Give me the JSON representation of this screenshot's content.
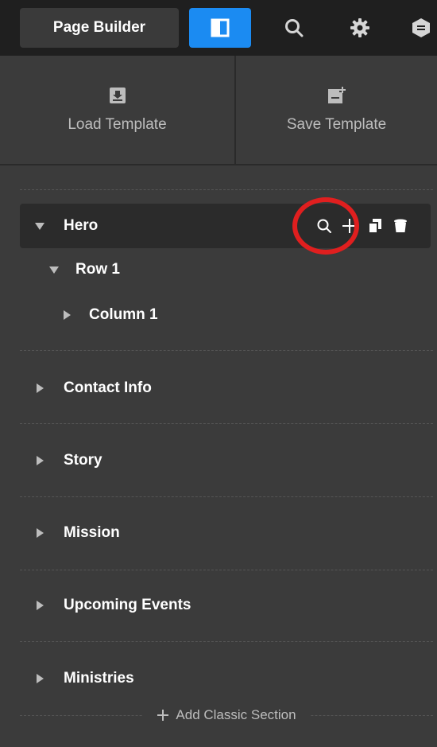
{
  "header": {
    "app_button_label": "Page Builder",
    "icons": [
      "layout-panel-icon",
      "search-icon",
      "gear-icon",
      "more-icon"
    ]
  },
  "templates": {
    "load_label": "Load Template",
    "save_label": "Save Template"
  },
  "tree": {
    "hero": {
      "label": "Hero",
      "expanded": true,
      "actions": [
        "search-icon",
        "plus-icon",
        "duplicate-icon",
        "delete-icon"
      ],
      "row": {
        "label": "Row 1",
        "expanded": true,
        "column": {
          "label": "Column 1",
          "expanded": false
        }
      }
    },
    "sections": [
      {
        "label": "Contact Info"
      },
      {
        "label": "Story"
      },
      {
        "label": "Mission"
      },
      {
        "label": "Upcoming Events"
      },
      {
        "label": "Ministries"
      }
    ]
  },
  "footer": {
    "add_section_label": "Add Classic Section"
  },
  "colors": {
    "accent": "#1b8bf2",
    "panel": "#3b3b3b",
    "topbar": "#1f1f1f",
    "highlight": "#e01f1f"
  }
}
